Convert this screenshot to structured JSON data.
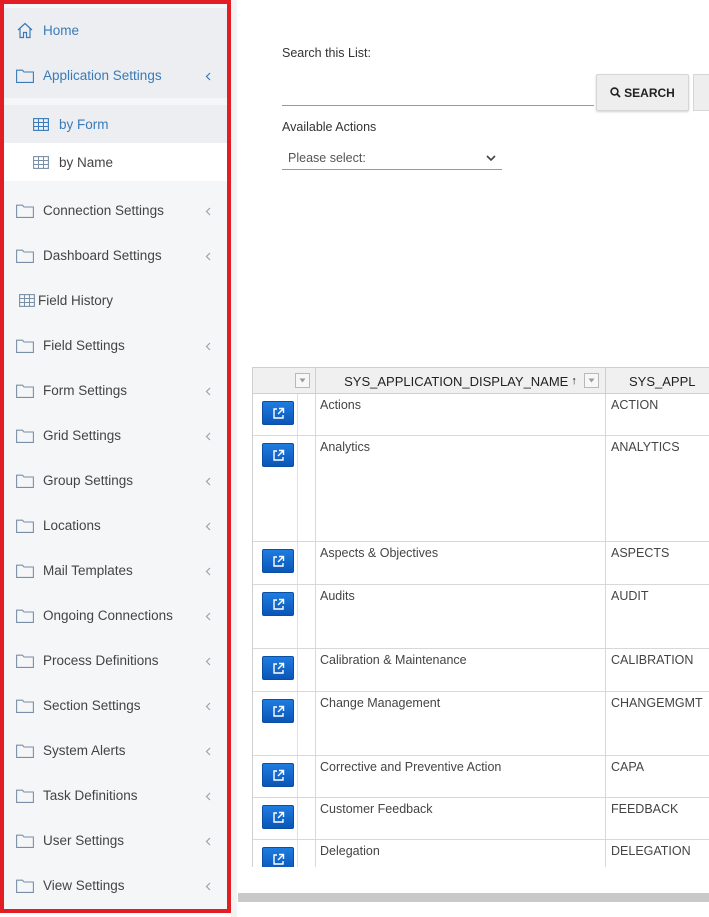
{
  "sidebar": {
    "home": "Home",
    "application_settings": "Application Settings",
    "sub_items": [
      "by Form",
      "by Name"
    ],
    "items": [
      {
        "label": "Connection Settings",
        "icon": "folder-icon"
      },
      {
        "label": "Dashboard Settings",
        "icon": "folder-icon"
      },
      {
        "label": "Field History",
        "icon": "table-icon"
      },
      {
        "label": "Field Settings",
        "icon": "folder-icon"
      },
      {
        "label": "Form Settings",
        "icon": "folder-icon"
      },
      {
        "label": "Grid Settings",
        "icon": "folder-icon"
      },
      {
        "label": "Group Settings",
        "icon": "folder-icon"
      },
      {
        "label": "Locations",
        "icon": "folder-icon"
      },
      {
        "label": "Mail Templates",
        "icon": "folder-icon"
      },
      {
        "label": "Ongoing Connections",
        "icon": "folder-icon"
      },
      {
        "label": "Process Definitions",
        "icon": "folder-icon"
      },
      {
        "label": "Section Settings",
        "icon": "folder-icon"
      },
      {
        "label": "System Alerts",
        "icon": "folder-icon"
      },
      {
        "label": "Task Definitions",
        "icon": "folder-icon"
      },
      {
        "label": "User Settings",
        "icon": "folder-icon"
      },
      {
        "label": "View Settings",
        "icon": "folder-icon"
      }
    ],
    "accent_color": "#3a7ab8",
    "highlight_border_color": "#e21d23"
  },
  "search": {
    "label": "Search this List:",
    "value": "",
    "placeholder": "",
    "button_label": "SEARCH"
  },
  "actions": {
    "label": "Available Actions",
    "selected": "Please select:"
  },
  "grid": {
    "columns": [
      "SYS_APPLICATION_DISPLAY_NAME",
      "SYS_APPL"
    ],
    "sort_indicator": "↑",
    "rows": [
      {
        "name": "Actions",
        "code": "ACTION"
      },
      {
        "name": "Analytics",
        "code": "ANALYTICS"
      },
      {
        "name": "Aspects & Objectives",
        "code": "ASPECTS"
      },
      {
        "name": "Audits",
        "code": "AUDIT"
      },
      {
        "name": "Calibration & Maintenance",
        "code": "CALIBRATION"
      },
      {
        "name": "Change Management",
        "code": "CHANGEMGMT"
      },
      {
        "name": "Corrective and Preventive Action",
        "code": "CAPA"
      },
      {
        "name": "Customer Feedback",
        "code": "FEEDBACK"
      },
      {
        "name": "Delegation",
        "code": "DELEGATION"
      }
    ],
    "edit_icon": "external-link-icon",
    "edit_button_color": "#1565c0"
  }
}
